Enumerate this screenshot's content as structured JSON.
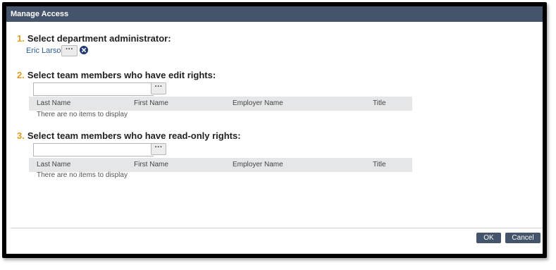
{
  "dialog": {
    "title": "Manage Access",
    "footer": {
      "ok_label": "OK",
      "cancel_label": "Cancel"
    }
  },
  "step1": {
    "number": "1.",
    "label": "Select department administrator:",
    "admin_name": "Eric Larson",
    "lookup_button": "···"
  },
  "step2": {
    "number": "2.",
    "label": "Select team members who have edit rights:",
    "input_value": "",
    "lookup_button": "···",
    "columns": [
      "Last Name",
      "First Name",
      "Employer Name",
      "Title"
    ],
    "empty_message": "There are no items to display"
  },
  "step3": {
    "number": "3.",
    "label": "Select team members who have read-only rights:",
    "input_value": "",
    "lookup_button": "···",
    "columns": [
      "Last Name",
      "First Name",
      "Employer Name",
      "Title"
    ],
    "empty_message": "There are no items to display"
  },
  "colors": {
    "titlebar": "#44546a",
    "step_number": "#e39b1e",
    "link": "#2a5e9e",
    "button": "#44546a"
  },
  "icons": {
    "clear": "clear-circle-icon"
  }
}
